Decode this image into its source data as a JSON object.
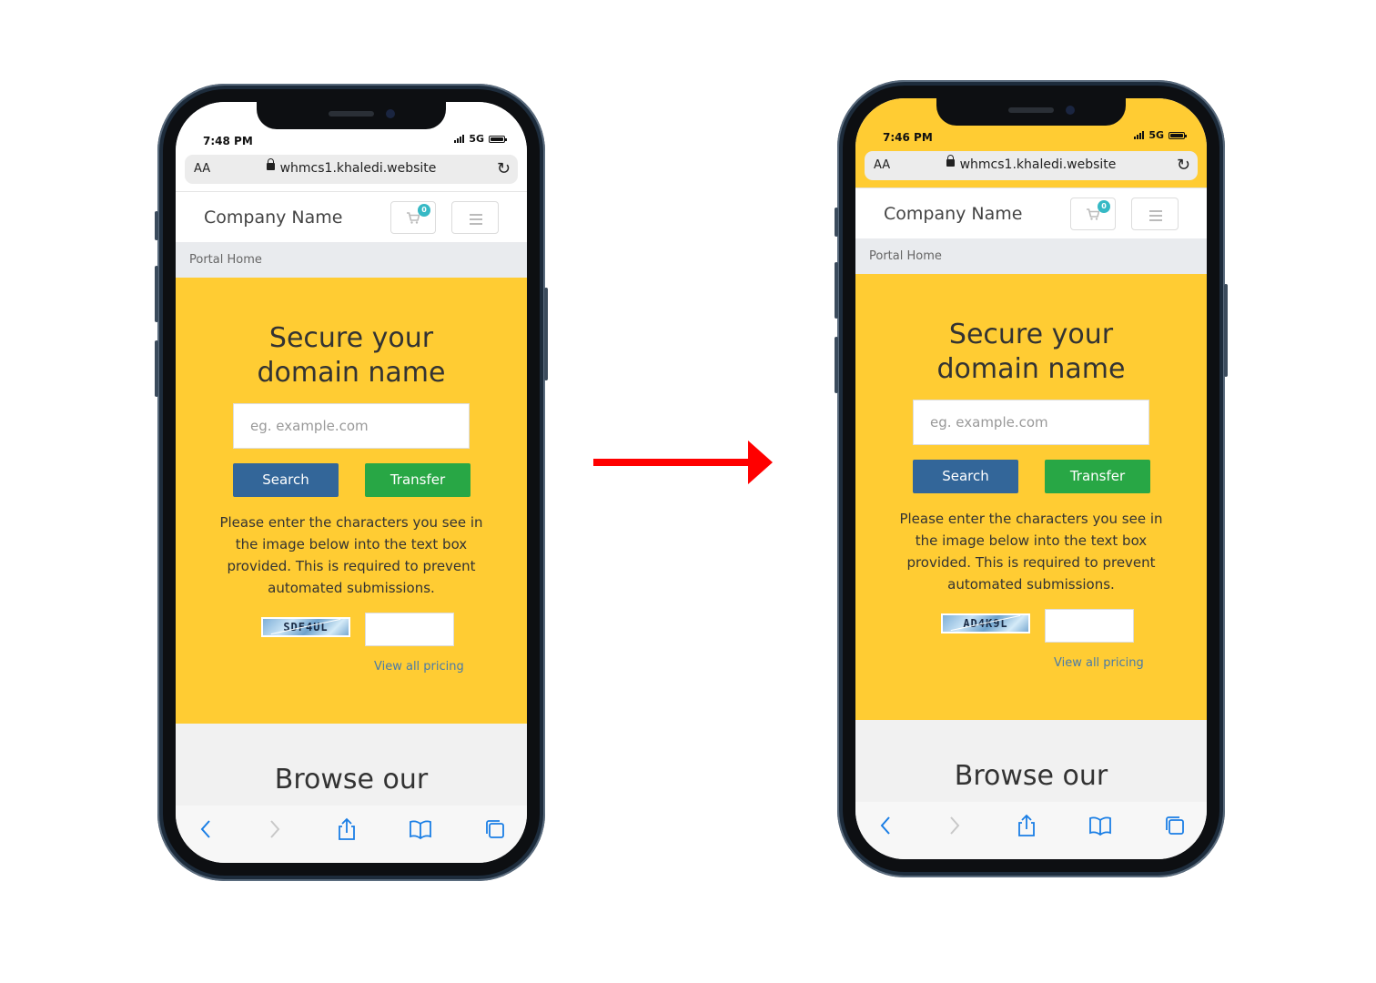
{
  "phones": [
    {
      "status_time": "7:48 PM",
      "network": "5G",
      "text_size_button": "AA",
      "url": "whmcs1.khaledi.website",
      "brand": "Company Name",
      "cart_count": "0",
      "breadcrumb": "Portal Home",
      "hero_title_line1": "Secure your",
      "hero_title_line2": "domain name",
      "domain_placeholder": "eg. example.com",
      "search_label": "Search",
      "transfer_label": "Transfer",
      "captcha_instructions": "Please enter the characters you see in the image below into the text box provided. This is required to prevent automated submissions.",
      "captcha_code": "SDF4UL",
      "pricing_link": "View all pricing",
      "browse_title": "Browse our"
    },
    {
      "status_time": "7:46 PM",
      "network": "5G",
      "text_size_button": "AA",
      "url": "whmcs1.khaledi.website",
      "brand": "Company Name",
      "cart_count": "0",
      "breadcrumb": "Portal Home",
      "hero_title_line1": "Secure your",
      "hero_title_line2": "domain name",
      "domain_placeholder": "eg. example.com",
      "search_label": "Search",
      "transfer_label": "Transfer",
      "captcha_instructions": "Please enter the characters you see in the image below into the text box provided. This is required to prevent automated submissions.",
      "captcha_code": "AD4K9L",
      "pricing_link": "View all pricing",
      "browse_title": "Browse our"
    }
  ],
  "colors": {
    "accent_yellow": "#ffcc33",
    "search_blue": "#336699",
    "transfer_green": "#28a745",
    "arrow_red": "#ff0000",
    "ios_blue": "#1a7ee5"
  },
  "icons": [
    "lock-icon",
    "reload-icon",
    "cart-icon",
    "hamburger-icon",
    "back-icon",
    "forward-icon",
    "share-icon",
    "bookmarks-icon",
    "tabs-icon",
    "right-arrow-icon"
  ]
}
